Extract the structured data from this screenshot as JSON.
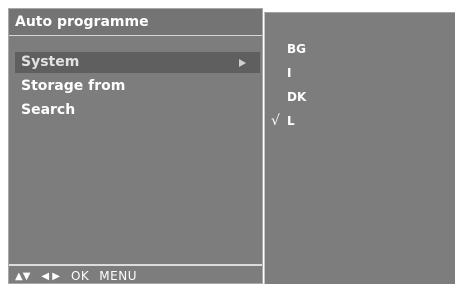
{
  "menu": {
    "title": "Auto programme",
    "items": [
      {
        "label": "System",
        "selected": true,
        "has_submenu": true
      },
      {
        "label": "Storage from",
        "selected": false,
        "has_submenu": false
      },
      {
        "label": "Search",
        "selected": false,
        "has_submenu": false
      }
    ]
  },
  "nav_hint": {
    "updown_glyph": "▲▼",
    "leftright_glyph": "◀ ▶",
    "ok": "OK",
    "menu": "MENU"
  },
  "system_options": [
    {
      "label": "BG",
      "checked": false
    },
    {
      "label": "I",
      "checked": false
    },
    {
      "label": "DK",
      "checked": false
    },
    {
      "label": "L",
      "checked": true
    }
  ],
  "check_mark": "√",
  "colors": {
    "panel_bg": "#7d7d7d",
    "highlight_bg": "#5f5f5f",
    "text": "#ffffff"
  },
  "icons": {
    "submenu_arrow": "triangle-right-icon",
    "check": "check-mark-icon"
  }
}
